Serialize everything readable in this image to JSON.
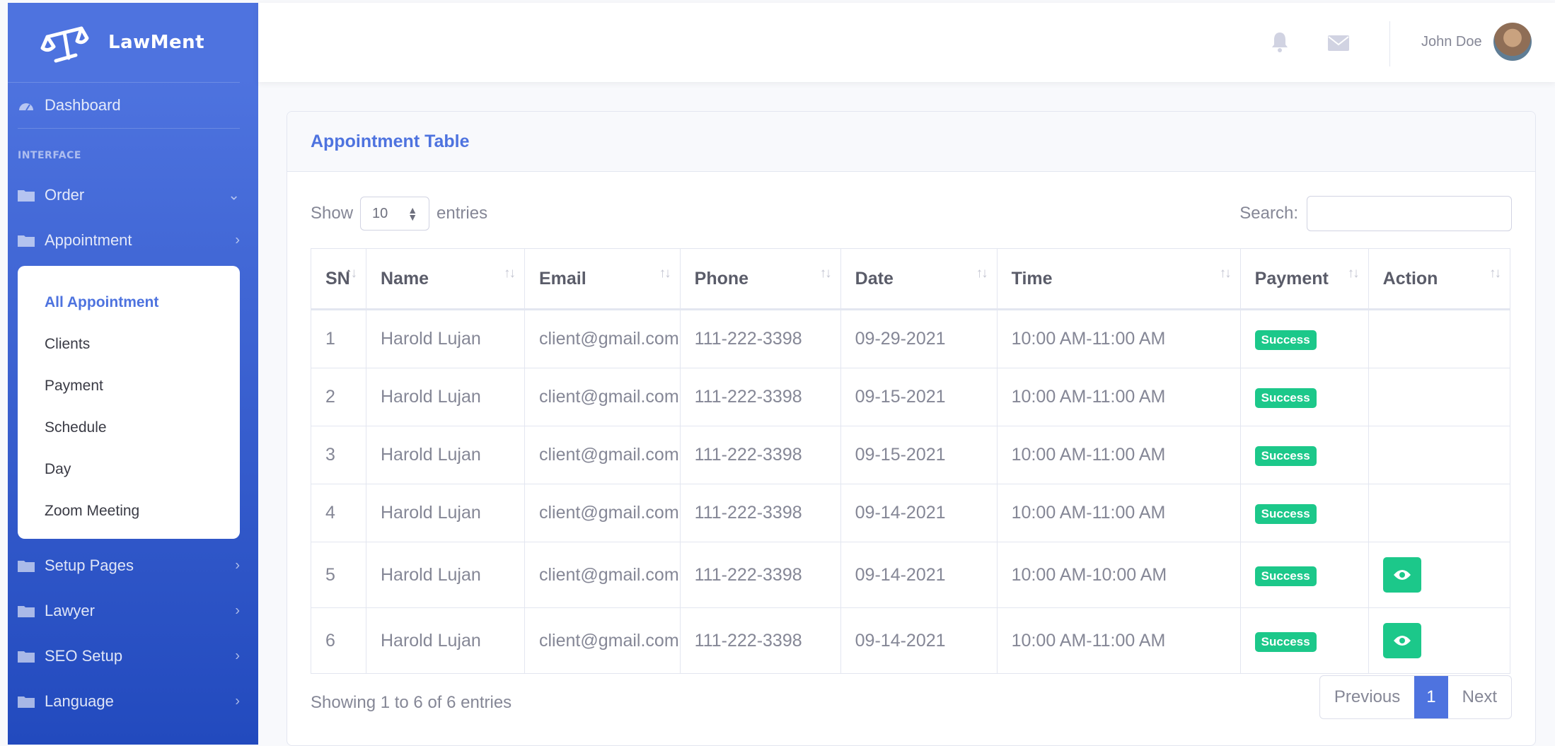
{
  "brand": {
    "name": "LawMent",
    "icon": "scales-logo-icon"
  },
  "sidebar": {
    "dashboard": "Dashboard",
    "heading": "INTERFACE",
    "order": "Order",
    "appointment": "Appointment",
    "submenu": [
      "All Appointment",
      "Clients",
      "Payment",
      "Schedule",
      "Day",
      "Zoom Meeting"
    ],
    "bottom": [
      "Setup Pages",
      "Lawyer",
      "SEO Setup",
      "Language"
    ]
  },
  "topbar": {
    "user_name": "John Doe"
  },
  "card": {
    "title": "Appointment Table",
    "show_label": "Show",
    "entries_label": "entries",
    "entries_value": "10",
    "search_label": "Search:",
    "search_value": ""
  },
  "table": {
    "headers": [
      "SN",
      "Name",
      "Email",
      "Phone",
      "Date",
      "Time",
      "Payment",
      "Action"
    ],
    "rows": [
      {
        "sn": "1",
        "name": "Harold Lujan",
        "email": "client@gmail.com",
        "phone": "111-222-3398",
        "date": "09-29-2021",
        "time": "10:00 AM-11:00 AM",
        "payment": "Success",
        "action": ""
      },
      {
        "sn": "2",
        "name": "Harold Lujan",
        "email": "client@gmail.com",
        "phone": "111-222-3398",
        "date": "09-15-2021",
        "time": "10:00 AM-11:00 AM",
        "payment": "Success",
        "action": ""
      },
      {
        "sn": "3",
        "name": "Harold Lujan",
        "email": "client@gmail.com",
        "phone": "111-222-3398",
        "date": "09-15-2021",
        "time": "10:00 AM-11:00 AM",
        "payment": "Success",
        "action": ""
      },
      {
        "sn": "4",
        "name": "Harold Lujan",
        "email": "client@gmail.com",
        "phone": "111-222-3398",
        "date": "09-14-2021",
        "time": "10:00 AM-11:00 AM",
        "payment": "Success",
        "action": ""
      },
      {
        "sn": "5",
        "name": "Harold Lujan",
        "email": "client@gmail.com",
        "phone": "111-222-3398",
        "date": "09-14-2021",
        "time": "10:00 AM-10:00 AM",
        "payment": "Success",
        "action": "eye-icon"
      },
      {
        "sn": "6",
        "name": "Harold Lujan",
        "email": "client@gmail.com",
        "phone": "111-222-3398",
        "date": "09-14-2021",
        "time": "10:00 AM-11:00 AM",
        "payment": "Success",
        "action": "eye-icon"
      }
    ]
  },
  "pagination": {
    "info": "Showing 1 to 6 of 6 entries",
    "previous": "Previous",
    "current": "1",
    "next": "Next"
  },
  "colors": {
    "primary": "#4e73df",
    "success": "#1cc88a",
    "text_muted": "#858796"
  }
}
